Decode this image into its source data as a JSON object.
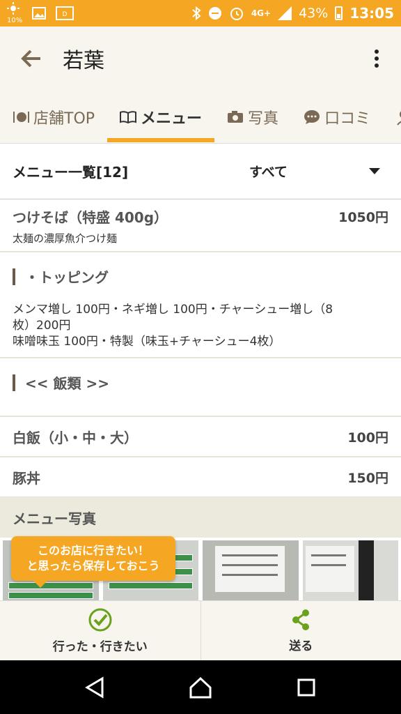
{
  "status_bar": {
    "signal_small_label": "10%",
    "network": "4G+",
    "battery_percent": "43%",
    "time": "13:05"
  },
  "app_bar": {
    "title": "若葉"
  },
  "tabs": [
    {
      "label": "店舗TOP",
      "icon": "fork-knife-icon",
      "active": false
    },
    {
      "label": "メニュー",
      "icon": "book-icon",
      "active": true
    },
    {
      "label": "写真",
      "icon": "camera-icon",
      "active": false
    },
    {
      "label": "口コミ",
      "icon": "speech-bubble-icon",
      "active": false
    }
  ],
  "menu_header": {
    "title": "メニュー一覧[12]",
    "filter_value": "すべて"
  },
  "menu_items": [
    {
      "name": "つけそば（特盛 400g）",
      "price": "1050円",
      "desc": "太麺の濃厚魚介つけ麺"
    }
  ],
  "topping_section": {
    "title": "・トッピング",
    "line1": "メンマ増し 100円・ネギ増し 100円・チャーシュー増し（8",
    "line2": "枚）200円",
    "line3": "味噌味玉 100円・特製（味玉+チャーシュー4枚）"
  },
  "rice_section": {
    "title": "<< 飯類 >>"
  },
  "rice_items": [
    {
      "name": "白飯（小・中・大）",
      "price": "100円"
    },
    {
      "name": "豚丼",
      "price": "150円"
    }
  ],
  "photo_section": {
    "title": "メニュー写真"
  },
  "tooltip": {
    "line1": "このお店に行きたい！",
    "line2": "と思ったら保存しておこう"
  },
  "actions": {
    "went_want": "行った・行きたい",
    "send": "送る"
  },
  "colors": {
    "accent": "#f5a623",
    "green": "#6aa21e",
    "header_bg": "#f7f5ee"
  }
}
